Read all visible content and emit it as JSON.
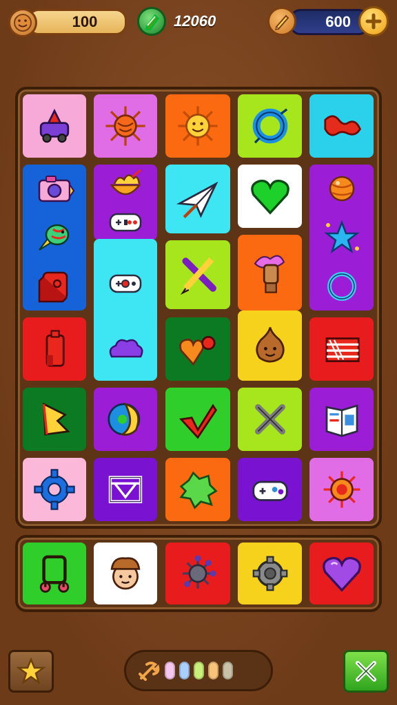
{
  "hud": {
    "cookies": "100",
    "gems": "12060",
    "pencils": "600"
  },
  "colors": {
    "pink": "#f7a9d8",
    "magenta": "#e06ce6",
    "orange": "#fb6a10",
    "lime": "#a7e61c",
    "cyan": "#2bd0ea",
    "blue": "#1662d8",
    "purple": "#9b1ed6",
    "aqua": "#3de6f2",
    "white": "#ffffff",
    "green": "#2fce2a",
    "darkgreen": "#0b7a22",
    "red": "#e81c1c",
    "yellow": "#f7d21c",
    "teal_cyan": "#41d7ee",
    "lightpink": "#fbb8d8",
    "violet": "#7a12d2"
  },
  "board": {
    "tiles": [
      {
        "icon": "car-icon",
        "color": "pink"
      },
      {
        "icon": "sun-icon",
        "color": "magenta"
      },
      {
        "icon": "smiling-sun-icon",
        "color": "orange"
      },
      {
        "icon": "blue-ring-icon",
        "color": "lime"
      },
      {
        "icon": "red-ribbon-icon",
        "color": "cyan"
      },
      {
        "icon": "paper-plane-icon",
        "color": "aqua"
      },
      {
        "icon": "green-heart-icon",
        "color": "white"
      },
      {
        "icon": "crossed-pencil-icon",
        "color": "lime"
      },
      {
        "icon": "paint-hand-icon",
        "color": "orange"
      },
      {
        "icon": "red-battery-icon",
        "color": "red"
      },
      {
        "icon": "orange-heart-icon",
        "color": "darkgreen"
      },
      {
        "icon": "onion-face-icon",
        "color": "yellow"
      },
      {
        "icon": "flag-icon",
        "color": "red"
      },
      {
        "icon": "yellow-flag-icon",
        "color": "darkgreen"
      },
      {
        "icon": "moon-globe-icon",
        "color": "purple"
      },
      {
        "icon": "red-check-icon",
        "color": "green"
      },
      {
        "icon": "bones-icon",
        "color": "lime"
      },
      {
        "icon": "book-icon",
        "color": "purple"
      },
      {
        "icon": "gear-icon",
        "color": "lightpink"
      },
      {
        "icon": "frame-icon",
        "color": "violet"
      },
      {
        "icon": "leaf-icon",
        "color": "orange"
      },
      {
        "icon": "gamepad-icon",
        "color": "violet"
      },
      {
        "icon": "flower-icon",
        "color": "magenta"
      }
    ],
    "stacks": [
      {
        "color": "blue",
        "items": [
          "camera-icon",
          "fish-icon",
          "dice-icon"
        ]
      },
      {
        "color": "purple",
        "items": [
          "taco-icon",
          "gamepad-icon"
        ]
      },
      {
        "color": "aqua",
        "items": [
          "gamepad-icon",
          "cloud-icon"
        ]
      },
      {
        "color": "purple",
        "items": [
          "planet-icon",
          "star-icon",
          "ring-icon"
        ]
      }
    ]
  },
  "tray": [
    {
      "icon": "mirror-icon",
      "color": "green"
    },
    {
      "icon": "chef-face-icon",
      "color": "white"
    },
    {
      "icon": "virus-icon",
      "color": "red"
    },
    {
      "icon": "wheel-icon",
      "color": "yellow"
    },
    {
      "icon": "purple-heart-icon",
      "color": "red"
    }
  ],
  "boosters": {
    "icon": "wrench-icon",
    "dots": [
      "#f7c6ef",
      "#a9cfff",
      "#c9f07a",
      "#f7c27a",
      "#c9c2a8"
    ]
  }
}
